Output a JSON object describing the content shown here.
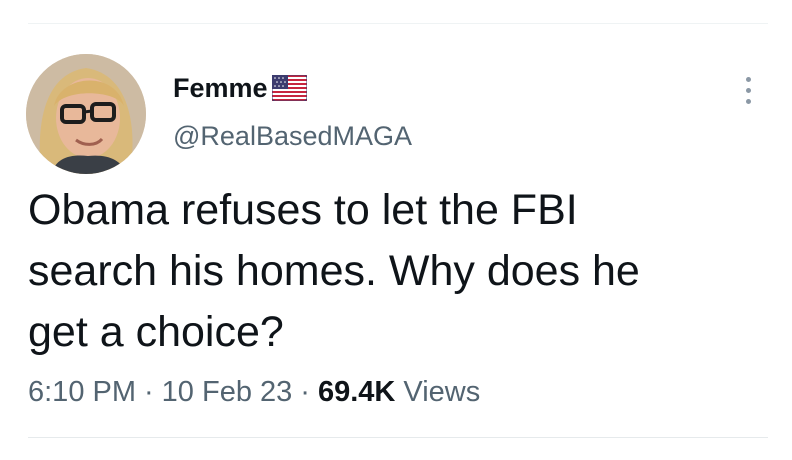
{
  "tweet": {
    "display_name": "Femme",
    "handle": "@RealBasedMAGA",
    "flag_icon": "us-flag-icon",
    "text": "Obama refuses to let the FBI\nsearch his homes. Why does he\nget a choice?",
    "time": "6:10 PM",
    "separator": "·",
    "date": "10 Feb 23",
    "views_count": "69.4K",
    "views_label": "Views",
    "more_icon": "more-vertical-icon"
  },
  "colors": {
    "text_primary": "#0f1419",
    "text_secondary": "#536471",
    "divider": "#eff3f4"
  }
}
